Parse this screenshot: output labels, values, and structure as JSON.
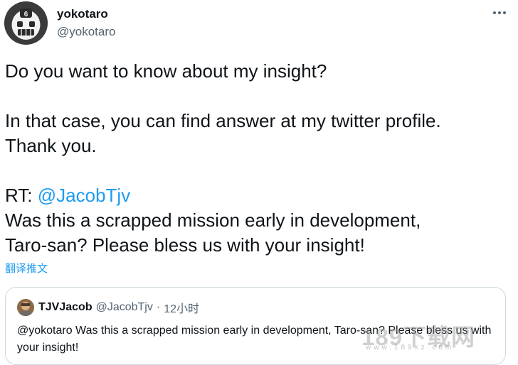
{
  "author": {
    "display_name": "yokotaro",
    "handle": "@yokotaro"
  },
  "tweet": {
    "line1": "Do you want to know about my insight?",
    "line2": "In that case, you can find answer at  my twitter profile.",
    "line3": "Thank you.",
    "rt_prefix": "RT: ",
    "rt_mention": "@JacobTjv",
    "line5": "Was this a scrapped mission early in development,",
    "line6": "Taro-san? Please bless us with your insight!"
  },
  "translate_label": "翻译推文",
  "quoted": {
    "name": "TJVJacob",
    "handle": "@JacobTjv",
    "separator": "·",
    "time": "12小时",
    "text": "@yokotaro Was this a scrapped mission early in development, Taro-san? Please bless us with your insight!"
  },
  "watermark": {
    "main": "189下载网",
    "url": "www.189xz.com"
  },
  "icons": {
    "avatar": "yokotaro-mask-icon",
    "more": "more-dots-icon",
    "quoted_avatar": "tjvjacob-avatar-icon"
  },
  "colors": {
    "link": "#1d9bf0",
    "secondary_text": "#536471",
    "border": "#cfd9de"
  }
}
